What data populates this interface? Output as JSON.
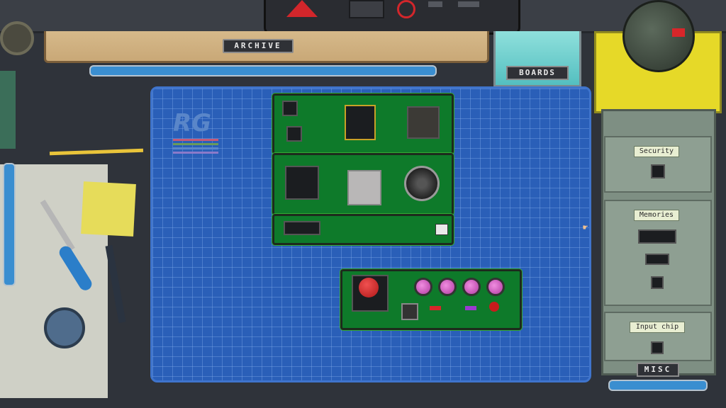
{
  "drawers": {
    "archive_label": "ARCHIVE",
    "boards_label": "BOARDS",
    "misc_label": "MISC"
  },
  "mat": {
    "logo": "RG"
  },
  "cabinet": {
    "sections": [
      {
        "label": "Security"
      },
      {
        "label": "Memories"
      },
      {
        "label": "Input chip"
      }
    ]
  },
  "colors": {
    "mat": "#2a5fb8",
    "pcb": "#0e7a2a",
    "accent_red": "#d2262b",
    "button_pink": "#c84fbd",
    "pipe_blue": "#3a8ed0"
  }
}
